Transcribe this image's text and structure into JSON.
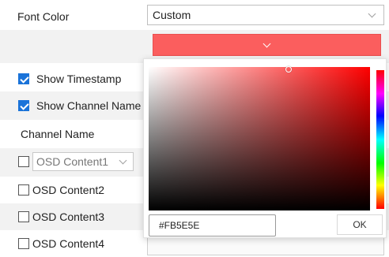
{
  "font_color": {
    "label": "Font Color",
    "select_value": "Custom",
    "swatch_color": "#FB5E5E"
  },
  "options": {
    "show_timestamp": {
      "label": "Show Timestamp",
      "checked": true
    },
    "show_channel_name": {
      "label": "Show Channel Name",
      "checked": true
    },
    "channel_name_label": "Channel Name"
  },
  "osd_contents": [
    {
      "label": "OSD Content1",
      "checked": false,
      "is_select": true
    },
    {
      "label": "OSD Content2",
      "checked": false
    },
    {
      "label": "OSD Content3",
      "checked": false
    },
    {
      "label": "OSD Content4",
      "checked": false
    }
  ],
  "color_picker": {
    "hex_value": "#FB5E5E",
    "ok_label": "OK",
    "hue_color": "#FF0000"
  },
  "icons": {
    "dropdown": "chevron-down-icon",
    "checkbox_checked": "checkbox-checked-icon",
    "checkbox_unchecked": "checkbox-unchecked-icon"
  }
}
